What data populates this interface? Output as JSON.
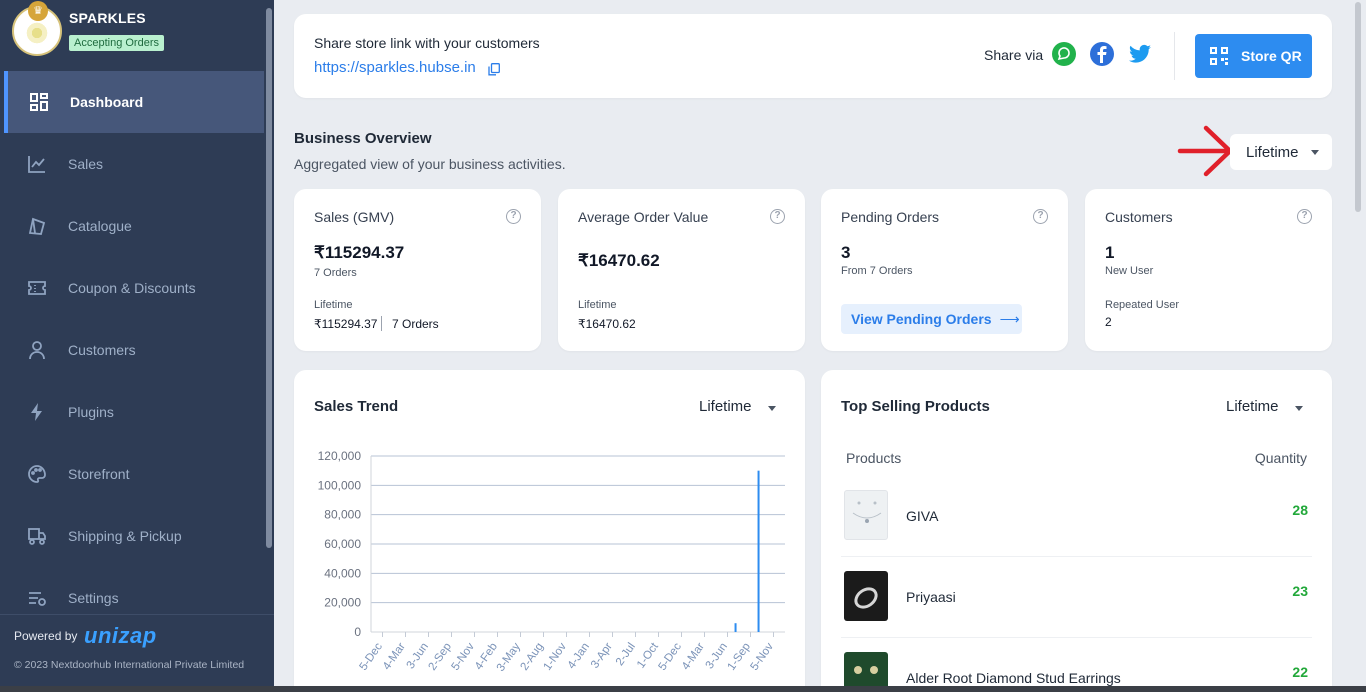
{
  "sidebar": {
    "store_name": "SPARKLES",
    "status_badge": "Accepting Orders",
    "items": [
      {
        "label": "Dashboard",
        "icon": "dashboard-icon",
        "active": true
      },
      {
        "label": "Sales",
        "icon": "chart-line-icon"
      },
      {
        "label": "Catalogue",
        "icon": "catalogue-icon"
      },
      {
        "label": "Coupon & Discounts",
        "icon": "coupon-icon"
      },
      {
        "label": "Customers",
        "icon": "user-icon"
      },
      {
        "label": "Plugins",
        "icon": "bolt-icon"
      },
      {
        "label": "Storefront",
        "icon": "palette-icon"
      },
      {
        "label": "Shipping & Pickup",
        "icon": "truck-icon"
      },
      {
        "label": "Settings",
        "icon": "settings-icon"
      }
    ],
    "powered_by": "Powered by",
    "brand": "unizap",
    "copyright": "© 2023 Nextdoorhub International Private Limited"
  },
  "share": {
    "title": "Share store link with your customers",
    "link": "https://sparkles.hubse.in",
    "share_via": "Share via",
    "store_qr": "Store QR"
  },
  "overview": {
    "title": "Business Overview",
    "subtitle": "Aggregated view of your business activities.",
    "period": "Lifetime"
  },
  "stats": {
    "sales": {
      "label": "Sales (GMV)",
      "value": "₹115294.37",
      "sub": "7 Orders",
      "period": "Lifetime",
      "period_value": "₹115294.37",
      "period_orders": "7 Orders"
    },
    "aov": {
      "label": "Average Order Value",
      "value": "₹16470.62",
      "period": "Lifetime",
      "period_value": "₹16470.62"
    },
    "pending": {
      "label": "Pending Orders",
      "value": "3",
      "sub": "From 7 Orders",
      "button": "View Pending Orders"
    },
    "customers": {
      "label": "Customers",
      "value": "1",
      "sub": "New User",
      "repeat_label": "Repeated User",
      "repeat_value": "2"
    }
  },
  "sales_trend": {
    "title": "Sales Trend",
    "period": "Lifetime"
  },
  "top_selling": {
    "title": "Top Selling Products",
    "period": "Lifetime",
    "col_products": "Products",
    "col_quantity": "Quantity",
    "rows": [
      {
        "name": "GIVA",
        "qty": "28"
      },
      {
        "name": "Priyaasi",
        "qty": "23"
      },
      {
        "name": "Alder Root Diamond Stud Earrings",
        "qty": "22"
      }
    ]
  },
  "colors": {
    "sidebar_bg": "#2e3c55",
    "accent": "#2d8cf0",
    "qty_green": "#22a83a"
  },
  "chart_data": {
    "type": "bar",
    "categories": [
      "5-Dec",
      "4-Mar",
      "3-Jun",
      "2-Sep",
      "5-Nov",
      "4-Feb",
      "3-May",
      "2-Aug",
      "1-Nov",
      "4-Jan",
      "3-Apr",
      "2-Jul",
      "1-Oct",
      "5-Dec",
      "4-Mar",
      "3-Jun",
      "1-Sep",
      "5-Nov"
    ],
    "values": [
      0,
      0,
      0,
      0,
      0,
      0,
      0,
      0,
      0,
      0,
      0,
      0,
      0,
      0,
      0,
      6000,
      110000,
      0
    ],
    "ylim": [
      0,
      120000
    ],
    "yticks": [
      "0",
      "20,000",
      "40,000",
      "60,000",
      "80,000",
      "100,000",
      "120,000"
    ],
    "grid": true,
    "xlabel": "",
    "ylabel": ""
  }
}
